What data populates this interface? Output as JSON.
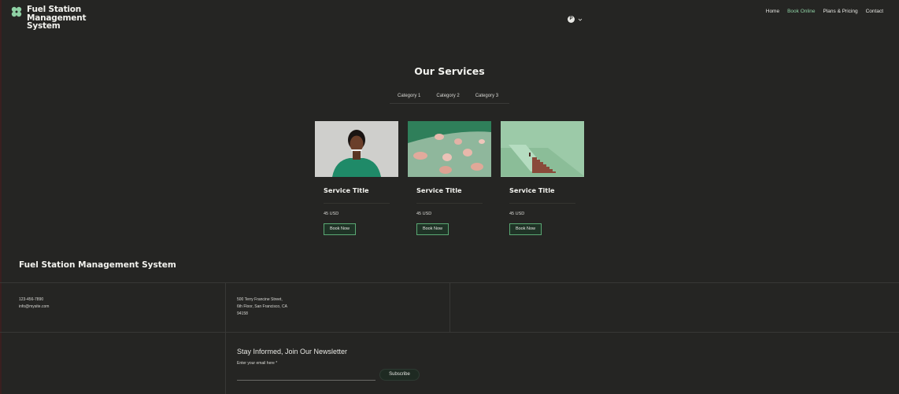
{
  "header": {
    "site_name": "Fuel Station Management System",
    "avatar_letter": "P",
    "nav": [
      "Home",
      "Book Online",
      "Plans & Pricing",
      "Contact"
    ],
    "active_nav": "Book Online"
  },
  "services": {
    "title": "Our Services",
    "tabs": [
      "Category 1",
      "Category 2",
      "Category 3"
    ],
    "active_tab": "Category 1",
    "cards": [
      {
        "title": "Service Title",
        "price": "45 USD",
        "button": "Book Now",
        "image": "woman-portrait"
      },
      {
        "title": "Service Title",
        "price": "45 USD",
        "button": "Book Now",
        "image": "ceramic-bowls"
      },
      {
        "title": "Service Title",
        "price": "45 USD",
        "button": "Book Now",
        "image": "staircase"
      }
    ]
  },
  "footer": {
    "title": "Fuel Station Management System",
    "phone": "123-456-7890",
    "email": "info@mysite.com",
    "address_line1": "500 Terry Francine Street,",
    "address_line2": "6th Floor, San Francisco, CA",
    "address_line3": "94158",
    "newsletter_title": "Stay Informed, Join Our Newsletter",
    "email_label": "Enter your email here *",
    "email_value": "",
    "subscribe_label": "Subscribe"
  },
  "colors": {
    "background": "#252523",
    "accent": "#8fd1a4",
    "button_border": "#5aa873"
  }
}
